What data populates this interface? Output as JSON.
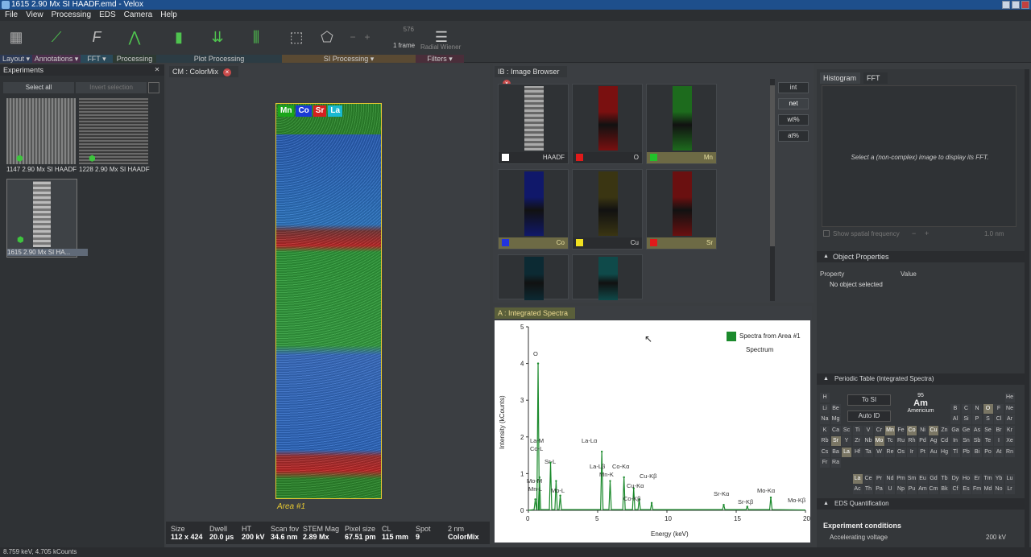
{
  "window": {
    "title": "1615 2.90 Mx SI HAADF.emd - Velox"
  },
  "menu": [
    "File",
    "View",
    "Processing",
    "EDS",
    "Camera",
    "Help"
  ],
  "toolbar": {
    "groups": [
      "Layout ▾",
      "Annotations ▾",
      "FFT ▾",
      "Processing",
      "Plot Processing",
      "SI Processing ▾",
      "Filters ▾"
    ],
    "frame_value": "576",
    "frame_label": "1 frame",
    "filter_label": "Radial Wiener"
  },
  "experiments": {
    "title": "Experiments",
    "select_all": "Select all",
    "invert_selection": "Invert selection",
    "items": [
      "1147 2.90 Mx SI HAADF",
      "1228 2.90 Mx SI HAADF",
      "1615 2.90 Mx SI HA..."
    ]
  },
  "colormix": {
    "tab": "CM : ColorMix",
    "elements": [
      {
        "label": "Mn",
        "color": "#1aa51a"
      },
      {
        "label": "Co",
        "color": "#1a3ad6"
      },
      {
        "label": "Sr",
        "color": "#d62020"
      },
      {
        "label": "La",
        "color": "#19b8d0"
      }
    ],
    "area_label": "Area #1",
    "info": [
      {
        "k": "Size",
        "v": "112 x 424"
      },
      {
        "k": "Dwell",
        "v": "20.0 µs"
      },
      {
        "k": "HT",
        "v": "200 kV"
      },
      {
        "k": "Scan fov",
        "v": "34.6 nm"
      },
      {
        "k": "STEM Mag",
        "v": "2.89 Mx"
      },
      {
        "k": "Pixel size",
        "v": "67.51 pm"
      },
      {
        "k": "CL",
        "v": "115 mm"
      },
      {
        "k": "Spot",
        "v": "9"
      },
      {
        "k": "2 nm",
        "v": "ColorMix"
      }
    ]
  },
  "image_browser": {
    "tab": "IB : Image Browser",
    "tiles": [
      {
        "label": "HAADF",
        "swatch": "#ffffff",
        "strip": "#888888"
      },
      {
        "label": "O",
        "swatch": "#e01a1a",
        "strip": "#7a1010"
      },
      {
        "label": "Mn",
        "swatch": "#22c22a",
        "strip": "#1d6b1d",
        "selected": true
      },
      {
        "label": "Co",
        "swatch": "#2233dd",
        "strip": "#10186a",
        "selected": true
      },
      {
        "label": "Cu",
        "swatch": "#f0e020",
        "strip": "#3a3512"
      },
      {
        "label": "Sr",
        "swatch": "#e01a1a",
        "strip": "#6a1010",
        "selected": true
      },
      {
        "label": "",
        "swatch": "",
        "strip": "#0c2a33"
      },
      {
        "label": "",
        "swatch": "",
        "strip": "#0f4a4a"
      }
    ],
    "buttons": [
      "int",
      "net",
      "wt%",
      "at%"
    ]
  },
  "spectra": {
    "tab": "A : Integrated Spectra",
    "legend_series": "Spectra from Area #1",
    "legend_sub": "Spectrum",
    "ylabel": "Intensity (kCounts)",
    "xlabel": "Energy (keV)",
    "yticks": [
      "0",
      "1",
      "2",
      "3",
      "4",
      "5"
    ],
    "xticks": [
      "0",
      "5",
      "10",
      "15",
      "20"
    ],
    "peaks": [
      "O",
      "La-M",
      "Co-L",
      "Sr-L",
      "Mo-M",
      "Mn-L",
      "Mo-L",
      "La-Lα",
      "La-Lβ",
      "Mn-K",
      "Co-Kα",
      "Cu-Kα",
      "Cu-Kβ",
      "Co-Kβ",
      "Sr-Kα",
      "Sr-Kβ",
      "Mo-Kα",
      "Mo-Kβ"
    ]
  },
  "chart_data": {
    "type": "line",
    "title": "",
    "xlabel": "Energy (keV)",
    "ylabel": "Intensity (kCounts)",
    "xlim": [
      0,
      20
    ],
    "ylim": [
      0,
      5
    ],
    "series": [
      {
        "name": "Spectra from Area #1",
        "x": [
          0.5,
          0.7,
          0.8,
          1.6,
          2.0,
          2.3,
          5.3,
          5.9,
          6.9,
          7.6,
          8.0,
          8.9,
          14.1,
          15.8,
          17.5
        ],
        "values": [
          0.3,
          4.0,
          0.9,
          1.3,
          0.8,
          0.4,
          1.6,
          0.8,
          0.9,
          0.6,
          0.3,
          0.2,
          0.15,
          0.1,
          0.35
        ]
      }
    ]
  },
  "right": {
    "tabs": [
      "Histogram",
      "FFT"
    ],
    "fft_msg": "Select a (non-complex) image to display its FFT.",
    "spatial": "Show spatial frequency",
    "spatial_val": "1.0 nm",
    "object_props": "Object Properties",
    "prop_col": "Property",
    "value_col": "Value",
    "no_object": "No object selected",
    "periodic_title": "Periodic Table (Integrated Spectra)",
    "to_si": "To SI",
    "auto_id": "Auto ID",
    "atomic_number": "95",
    "symbol": "Am",
    "element_name": "Americium",
    "eds_quant": "EDS Quantification",
    "exp_cond": "Experiment conditions",
    "acc_voltage_label": "Accelerating voltage",
    "acc_voltage": "200 kV"
  },
  "status": "8.759 keV, 4.705 kCounts"
}
